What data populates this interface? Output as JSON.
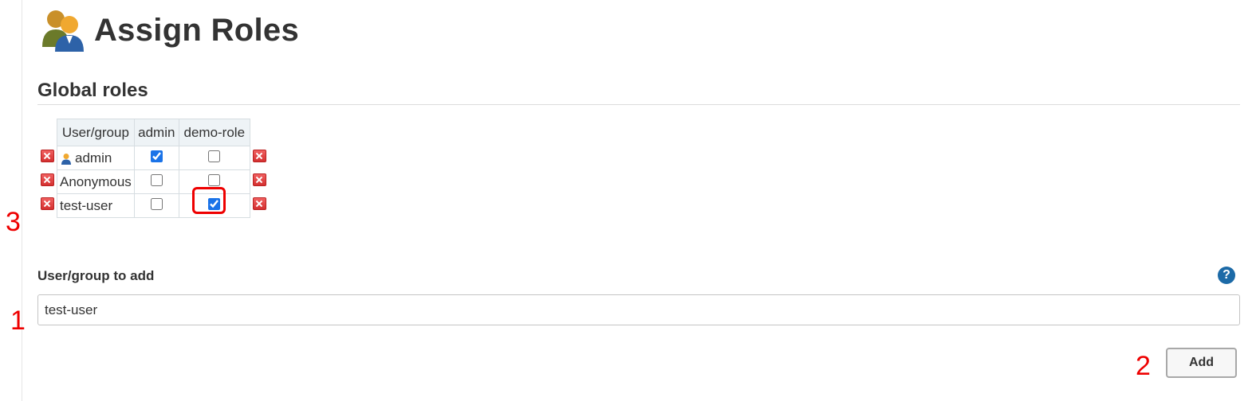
{
  "page": {
    "title": "Assign Roles"
  },
  "global_roles": {
    "title": "Global roles",
    "header": {
      "user_group": "User/group",
      "roles": [
        "admin",
        "demo-role"
      ]
    },
    "rows": [
      {
        "name": "admin",
        "has_icon": true,
        "checked": [
          true,
          false
        ]
      },
      {
        "name": "Anonymous",
        "has_icon": false,
        "checked": [
          false,
          false
        ]
      },
      {
        "name": "test-user",
        "has_icon": false,
        "checked": [
          false,
          true
        ],
        "highlight_index": 1
      }
    ]
  },
  "add_user": {
    "label": "User/group to add",
    "value": "test-user",
    "button_label": "Add",
    "help_glyph": "?"
  },
  "annotations": {
    "step1": "1",
    "step2": "2",
    "step3": "3",
    "highlight_color": "#e00000"
  },
  "icons": {
    "page": "users-icon",
    "delete": "delete-x-icon",
    "user": "user-icon",
    "help": "help-icon"
  }
}
